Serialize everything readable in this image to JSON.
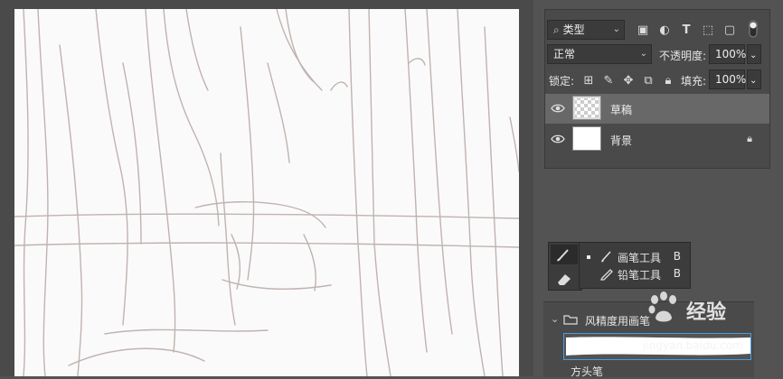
{
  "layers_panel": {
    "filter_kind": "类型",
    "blend_mode": "正常",
    "opacity_label": "不透明度:",
    "opacity_value": "100%",
    "lock_label": "锁定:",
    "fill_label": "填充:",
    "fill_value": "100%",
    "layers": [
      {
        "name": "草稿",
        "selected": true,
        "locked": false,
        "thumbnail": "transparent"
      },
      {
        "name": "背景",
        "selected": false,
        "locked": true,
        "thumbnail": "white"
      }
    ]
  },
  "tool_flyout": {
    "items": [
      {
        "name": "画笔工具",
        "shortcut": "B",
        "active": true
      },
      {
        "name": "铅笔工具",
        "shortcut": "B",
        "active": false
      }
    ]
  },
  "brush_presets": {
    "group_name": "风精度用画笔",
    "preset_name": "方头笔"
  },
  "watermark": {
    "brand": "经验",
    "url": "jingyan.baidu.com"
  },
  "icons": {
    "filter": "search-icon",
    "filter_types": [
      "image-filter-icon",
      "adjustment-filter-icon",
      "type-filter-icon",
      "shape-filter-icon",
      "smart-object-filter-icon",
      "filter-toggle-icon"
    ],
    "locks": [
      "lock-transparent-icon",
      "lock-paint-icon",
      "lock-position-icon",
      "lock-artboard-icon",
      "lock-all-icon"
    ]
  },
  "colors": {
    "panel_bg": "#4a4a4a",
    "selected_row": "#686868",
    "accent_border": "#4a9be0",
    "sketch_stroke": "#b7a8a4"
  }
}
